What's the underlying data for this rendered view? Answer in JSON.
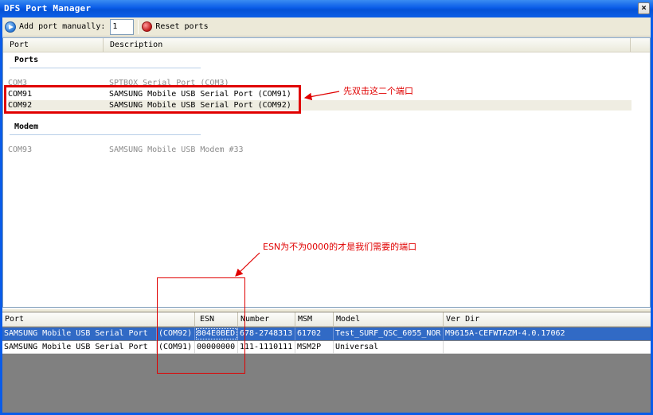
{
  "window": {
    "title": "DFS Port Manager",
    "close_label": "×"
  },
  "toolbar": {
    "add_port_label": "Add port manually:",
    "port_input_value": "1",
    "reset_label": "Reset ports"
  },
  "top_list": {
    "columns": [
      "Port",
      "Description"
    ],
    "groups": [
      {
        "label": "Ports",
        "rows": [
          {
            "port": "COM3",
            "description": "SPTBOX Serial Port (COM3)"
          },
          {
            "port": "COM91",
            "description": "SAMSUNG Mobile USB Serial Port  (COM91)"
          },
          {
            "port": "COM92",
            "description": "SAMSUNG Mobile USB Serial Port  (COM92)"
          }
        ]
      },
      {
        "label": "Modem",
        "rows": [
          {
            "port": "COM93",
            "description": "SAMSUNG Mobile USB Modem #33"
          }
        ]
      }
    ]
  },
  "bottom_grid": {
    "columns": [
      "Port",
      "ESN",
      "Number",
      "MSM",
      "Model",
      "Ver Dir"
    ],
    "rows": [
      {
        "port": "SAMSUNG Mobile USB Serial Port",
        "port_suffix": "(COM92)",
        "esn": "804E0BED",
        "number": "678-2748313",
        "msm": "61702",
        "model": "Test_SURF_QSC_6055_NOR",
        "ver_dir": "M9615A-CEFWTAZM-4.0.17062"
      },
      {
        "port": "SAMSUNG Mobile USB Serial Port",
        "port_suffix": "(COM91)",
        "esn": "00000000",
        "number": "111-1110111",
        "msm": "MSM2P",
        "model": "Universal",
        "ver_dir": ""
      }
    ]
  },
  "annotations": {
    "note1": "先双击这二个端口",
    "note2": "ESN为不为0000的才是我们需要的端口"
  },
  "colors": {
    "titlebar": "#0a5ce8",
    "selection": "#316ac5",
    "annotation": "#e00000"
  }
}
